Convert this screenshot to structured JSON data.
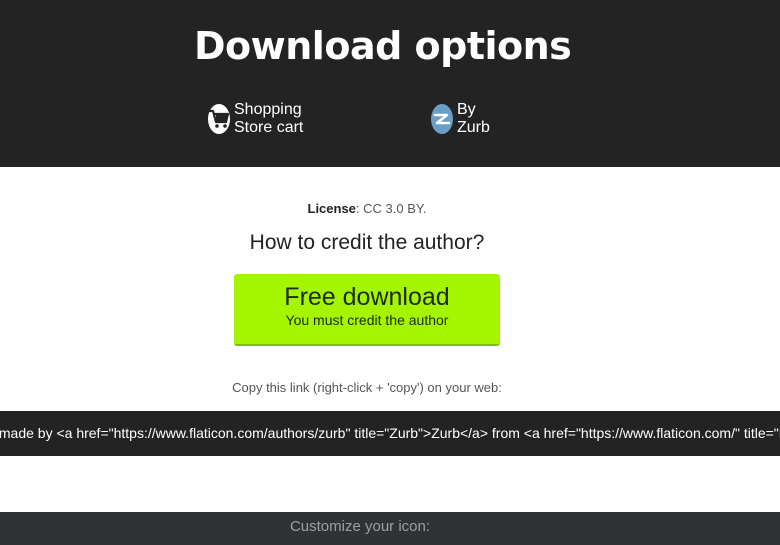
{
  "header": {
    "title": "Download options",
    "pack_label": "Shopping Store cart",
    "pack_icon": "shopping-cart-icon",
    "author_label": "By Zurb",
    "author_icon": "zurb-logo-icon"
  },
  "license": {
    "label": "License",
    "value": ": CC 3.0 BY."
  },
  "credit_question": "How to credit the author?",
  "download_button": {
    "title": "Free download",
    "subtitle": "You must credit the author",
    "color": "#a6f500"
  },
  "copy_hint": "Copy this link (right-click + 'copy') on your web:",
  "attribution_code": "s made by <a href=\"https://www.flaticon.com/authors/zurb\" title=\"Zurb\">Zurb</a> from <a href=\"https://www.flaticon.com/\" title=\"Flaticon\">www.flaticon.com</a>",
  "customize_label": "Customize your icon:",
  "colors": {
    "header_bg": "#232323",
    "accent": "#a6f500"
  }
}
